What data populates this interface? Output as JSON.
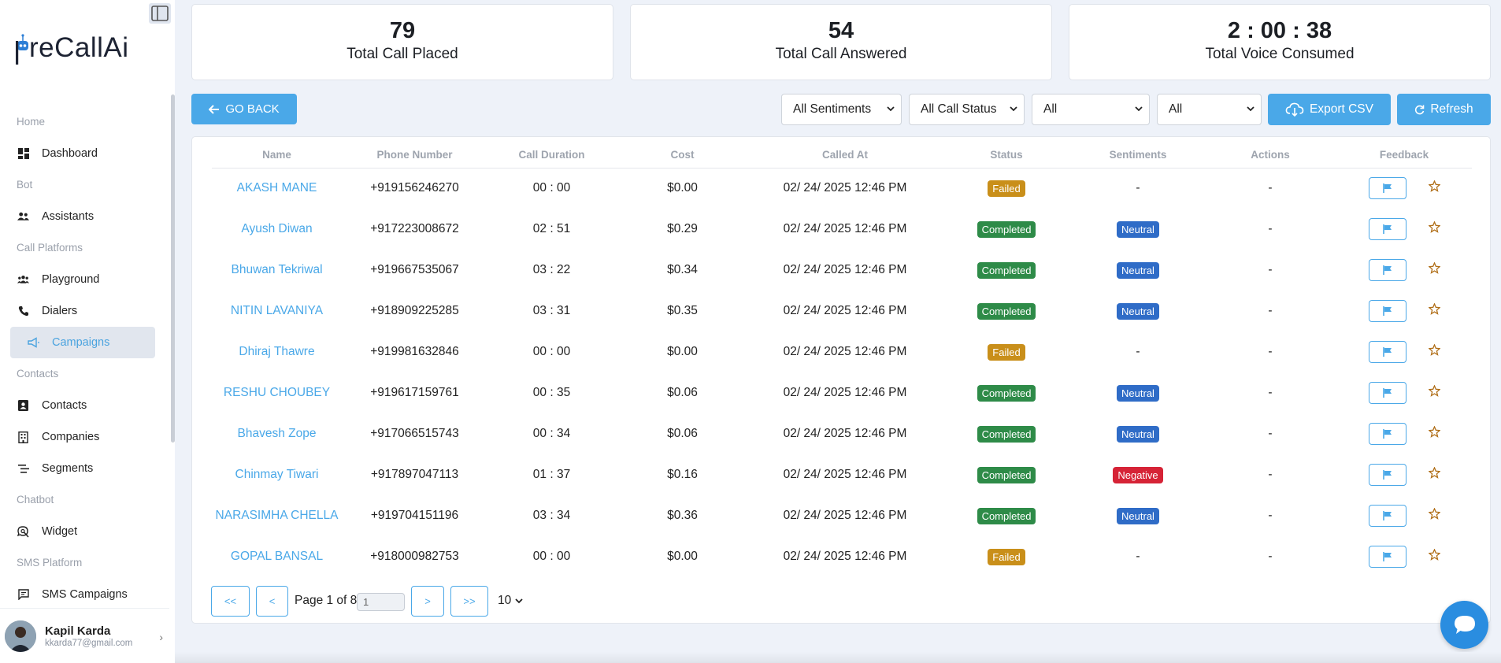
{
  "brand": {
    "logo_text": "reCallAi",
    "logo_letter": "P"
  },
  "nav": [
    {
      "type": "section",
      "label": "Home"
    },
    {
      "type": "item",
      "label": "Dashboard",
      "icon": "dashboard-icon"
    },
    {
      "type": "section",
      "label": "Bot"
    },
    {
      "type": "item",
      "label": "Assistants",
      "icon": "users-icon"
    },
    {
      "type": "section",
      "label": "Call Platforms"
    },
    {
      "type": "item",
      "label": "Playground",
      "icon": "group-icon"
    },
    {
      "type": "item",
      "label": "Dialers",
      "icon": "phone-icon"
    },
    {
      "type": "item",
      "label": "Campaigns",
      "icon": "megaphone-icon",
      "active": true
    },
    {
      "type": "section",
      "label": "Contacts"
    },
    {
      "type": "item",
      "label": "Contacts",
      "icon": "contact-card-icon"
    },
    {
      "type": "item",
      "label": "Companies",
      "icon": "building-icon"
    },
    {
      "type": "item",
      "label": "Segments",
      "icon": "segments-icon"
    },
    {
      "type": "section",
      "label": "Chatbot"
    },
    {
      "type": "item",
      "label": "Widget",
      "icon": "chat-search-icon"
    },
    {
      "type": "section",
      "label": "SMS Platform"
    },
    {
      "type": "item",
      "label": "SMS Campaigns",
      "icon": "message-icon"
    }
  ],
  "user": {
    "name": "Kapil Karda",
    "email": "kkarda77@gmail.com"
  },
  "stats": [
    {
      "value": "79",
      "label": "Total Call Placed"
    },
    {
      "value": "54",
      "label": "Total Call Answered"
    },
    {
      "value": "2 : 00 : 38",
      "label": "Total Voice Consumed"
    }
  ],
  "toolbar": {
    "go_back": "GO BACK",
    "filters": [
      "All Sentiments",
      "All Call Status",
      "All",
      "All"
    ],
    "export": "Export CSV",
    "refresh": "Refresh"
  },
  "table": {
    "headers": [
      "Name",
      "Phone Number",
      "Call Duration",
      "Cost",
      "Called At",
      "Status",
      "Sentiments",
      "Actions",
      "Feedback"
    ],
    "rows": [
      {
        "name": "AKASH MANE",
        "phone": "+919156246270",
        "duration": "00 : 00",
        "cost": "$0.00",
        "called_at": "02/ 24/ 2025 12:46 PM",
        "status": "Failed",
        "sentiment": "-",
        "actions": "-"
      },
      {
        "name": "Ayush Diwan",
        "phone": "+917223008672",
        "duration": "02 : 51",
        "cost": "$0.29",
        "called_at": "02/ 24/ 2025 12:46 PM",
        "status": "Completed",
        "sentiment": "Neutral",
        "actions": "-"
      },
      {
        "name": "Bhuwan Tekriwal",
        "phone": "+919667535067",
        "duration": "03 : 22",
        "cost": "$0.34",
        "called_at": "02/ 24/ 2025 12:46 PM",
        "status": "Completed",
        "sentiment": "Neutral",
        "actions": "-"
      },
      {
        "name": "NITIN LAVANIYA",
        "phone": "+918909225285",
        "duration": "03 : 31",
        "cost": "$0.35",
        "called_at": "02/ 24/ 2025 12:46 PM",
        "status": "Completed",
        "sentiment": "Neutral",
        "actions": "-"
      },
      {
        "name": "Dhiraj Thawre",
        "phone": "+919981632846",
        "duration": "00 : 00",
        "cost": "$0.00",
        "called_at": "02/ 24/ 2025 12:46 PM",
        "status": "Failed",
        "sentiment": "-",
        "actions": "-"
      },
      {
        "name": "RESHU CHOUBEY",
        "phone": "+919617159761",
        "duration": "00 : 35",
        "cost": "$0.06",
        "called_at": "02/ 24/ 2025 12:46 PM",
        "status": "Completed",
        "sentiment": "Neutral",
        "actions": "-"
      },
      {
        "name": "Bhavesh Zope",
        "phone": "+917066515743",
        "duration": "00 : 34",
        "cost": "$0.06",
        "called_at": "02/ 24/ 2025 12:46 PM",
        "status": "Completed",
        "sentiment": "Neutral",
        "actions": "-"
      },
      {
        "name": "Chinmay Tiwari",
        "phone": "+917897047113",
        "duration": "01 : 37",
        "cost": "$0.16",
        "called_at": "02/ 24/ 2025 12:46 PM",
        "status": "Completed",
        "sentiment": "Negative",
        "actions": "-"
      },
      {
        "name": "NARASIMHA CHELLA",
        "phone": "+919704151196",
        "duration": "03 : 34",
        "cost": "$0.36",
        "called_at": "02/ 24/ 2025 12:46 PM",
        "status": "Completed",
        "sentiment": "Neutral",
        "actions": "-"
      },
      {
        "name": "GOPAL BANSAL",
        "phone": "+918000982753",
        "duration": "00 : 00",
        "cost": "$0.00",
        "called_at": "02/ 24/ 2025 12:46 PM",
        "status": "Failed",
        "sentiment": "-",
        "actions": "-"
      }
    ]
  },
  "pagination": {
    "first": "<<",
    "prev": "<",
    "next": ">",
    "last": ">>",
    "page_text": "Page 1 of 8",
    "page_input": "1",
    "page_size": "10"
  },
  "colors": {
    "accent": "#4aa8e8",
    "failed": "#c98f1a",
    "completed": "#2e8b48",
    "neutral": "#2f6cc7",
    "negative": "#d62336"
  }
}
